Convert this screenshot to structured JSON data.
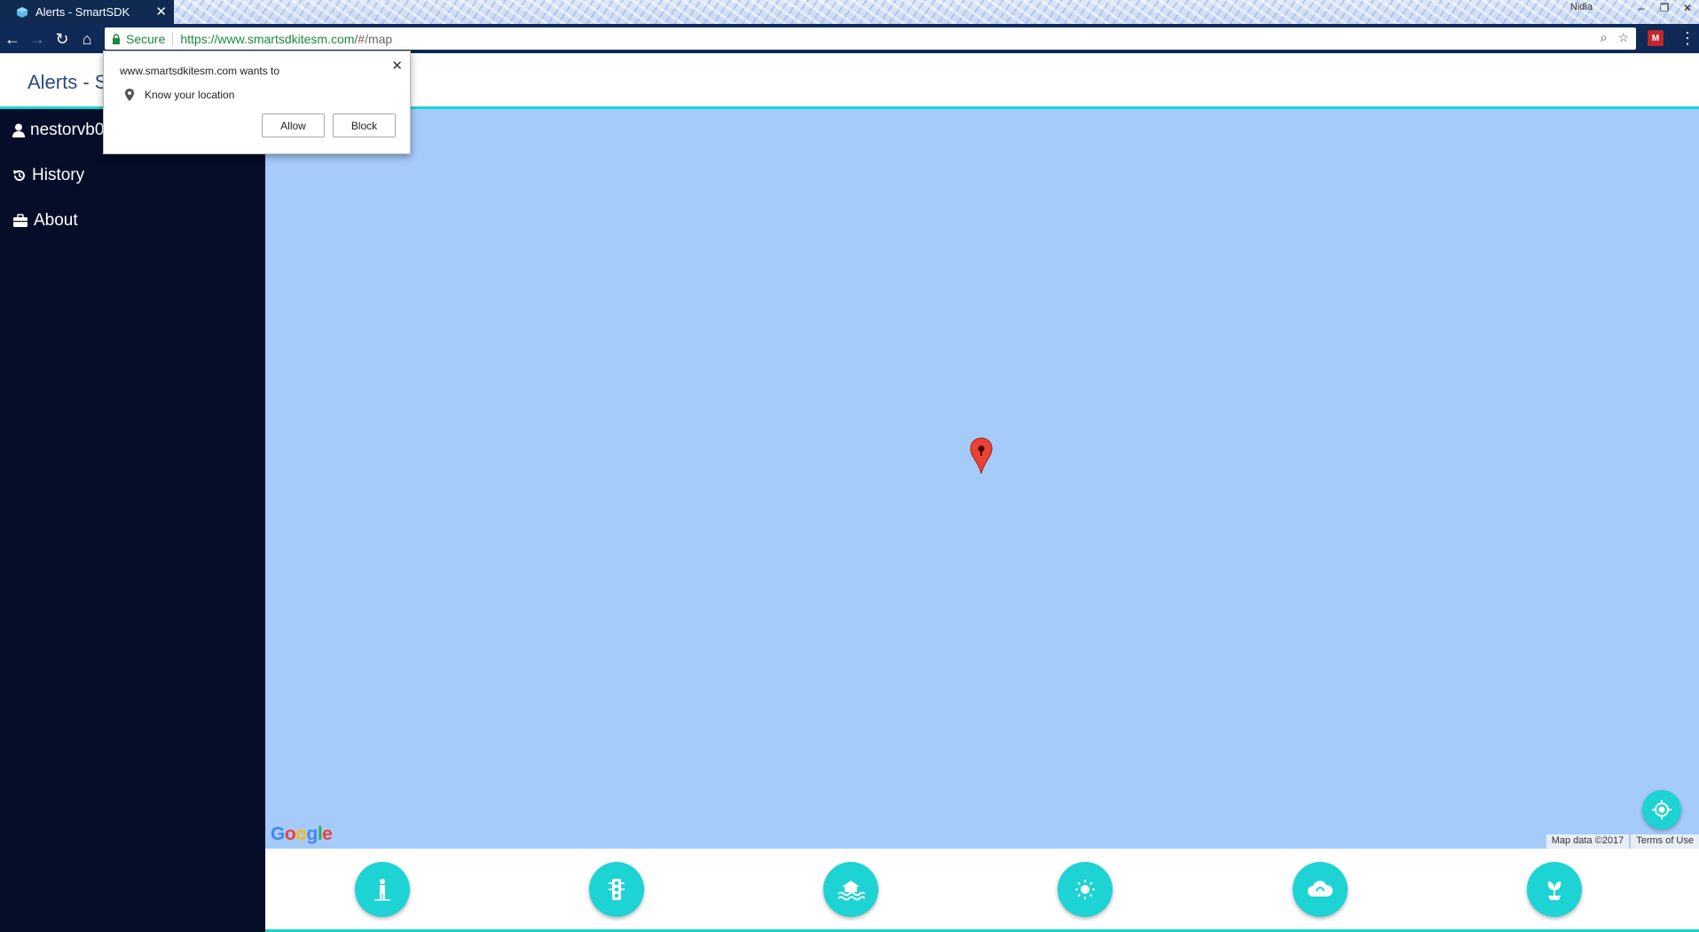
{
  "browser": {
    "tab_title": "Alerts - SmartSDK",
    "window_user": "Nidia",
    "secure_label": "Secure",
    "url_host": "https://www.smartsdkitesm.com",
    "url_path": "/#/map"
  },
  "app": {
    "title": "Alerts - S"
  },
  "sidebar": {
    "items": [
      {
        "label": "nestorvb0",
        "icon": "user-icon"
      },
      {
        "label": "History",
        "icon": "history-icon"
      },
      {
        "label": "About",
        "icon": "briefcase-icon"
      }
    ]
  },
  "map": {
    "attribution": "Map data ©2017",
    "terms": "Terms of Use",
    "logo_letters": [
      "G",
      "o",
      "o",
      "g",
      "l",
      "e"
    ]
  },
  "bottom_actions": [
    {
      "name": "pedestrian-alert",
      "icon": "person-icon"
    },
    {
      "name": "traffic-alert",
      "icon": "traffic-light-icon"
    },
    {
      "name": "flood-alert",
      "icon": "flood-icon"
    },
    {
      "name": "weather-alert",
      "icon": "sun-icon"
    },
    {
      "name": "environment-alert",
      "icon": "cloud-icon"
    },
    {
      "name": "health-alert",
      "icon": "plant-icon"
    }
  ],
  "permission_popup": {
    "title": "www.smartsdkitesm.com wants to",
    "request": "Know your location",
    "allow_label": "Allow",
    "block_label": "Block"
  },
  "colors": {
    "accent": "#1dd3d3",
    "sidebar_bg": "#050d28",
    "map_water": "#a5cbfb",
    "marker": "#ea4335"
  }
}
